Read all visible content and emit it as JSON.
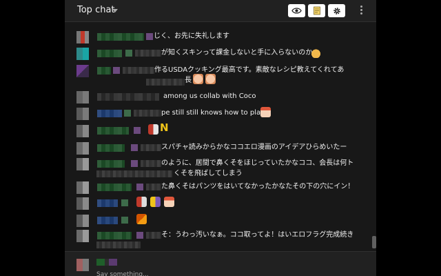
{
  "header": {
    "title": "Top chat",
    "icons": [
      "eye-icon",
      "note-icon",
      "gear-icon",
      "more-vert-icon"
    ]
  },
  "messages": [
    {
      "text": "じく、お先に失礼します",
      "emojis": []
    },
    {
      "text": "が知くスキンって課金しないと手に入らないのか",
      "emojis": [
        "cat-emoji"
      ]
    },
    {
      "text": "作るUSDAクッキング最高です。素敵なレシピ教えてくれてあ",
      "text2": "長",
      "emojis": [
        "face-emoji",
        "face-emoji"
      ]
    },
    {
      "text": "among us collab with Coco",
      "emojis": []
    },
    {
      "text": "pe still still knows how to play",
      "emojis": [
        "face-emoji"
      ]
    },
    {
      "text": "N",
      "emojis": [
        "pixel-emoji"
      ]
    },
    {
      "text": "スパチャ読みからかなココエロ漫画のアイデアひらめいたー",
      "emojis": []
    },
    {
      "text": "のように、居間で鼻くそをほじっていたかなココ、会長は何ト",
      "text2": "くそを飛ばしてしまう",
      "emojis": []
    },
    {
      "text": "た鼻くそはパンツをはいてなかったかなたその下の穴にイン！",
      "emojis": []
    },
    {
      "text": "",
      "emojis": [
        "pixel-emoji",
        "pixel-emoji",
        "face-emoji"
      ]
    },
    {
      "text": "",
      "emojis": [
        "pixel-emoji"
      ]
    },
    {
      "text": "そ：うわっ汚いなぁ。ココ取ってよ！はいエロフラグ完成続き",
      "emojis": []
    }
  ],
  "input": {
    "placeholder": "Say something..."
  },
  "colors": {
    "background": "#181818",
    "header": "#212121",
    "text": "#f1f1f1"
  }
}
